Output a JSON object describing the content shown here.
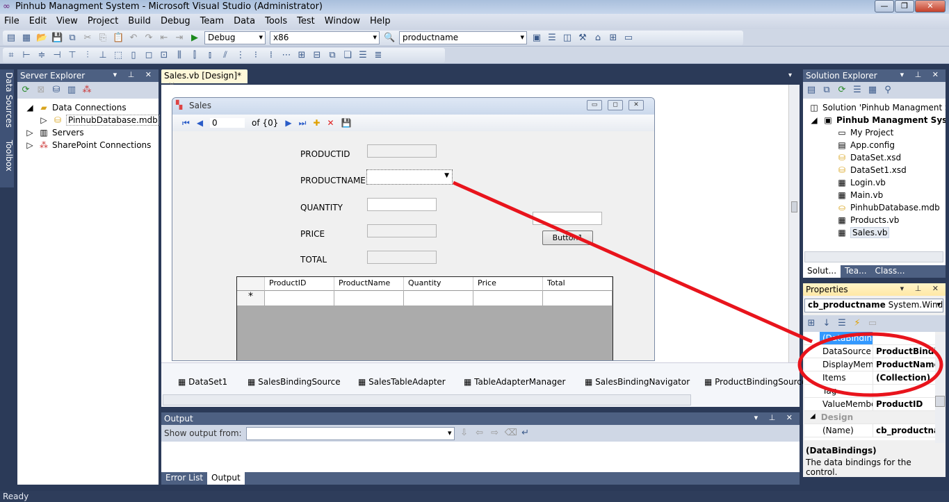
{
  "window": {
    "title": "Pinhub Managment System - Microsoft Visual Studio (Administrator)"
  },
  "menu": [
    "File",
    "Edit",
    "View",
    "Project",
    "Build",
    "Debug",
    "Team",
    "Data",
    "Tools",
    "Test",
    "Window",
    "Help"
  ],
  "toolbar": {
    "config": "Debug",
    "platform": "x86",
    "find": "productname"
  },
  "side_tabs": {
    "data_sources": "Data Sources",
    "toolbox": "Toolbox"
  },
  "server_explorer": {
    "title": "Server Explorer",
    "items": [
      "Data Connections",
      "PinhubDatabase.mdb",
      "Servers",
      "SharePoint Connections"
    ]
  },
  "document": {
    "tab": "Sales.vb [Design]*"
  },
  "form": {
    "title": "Sales",
    "nav_position": "0",
    "nav_count": "of {0}",
    "labels": [
      "PRODUCTID",
      "PRODUCTNAME",
      "QUANTITY",
      "PRICE",
      "TOTAL"
    ],
    "button": "Button1",
    "grid_columns": [
      "ProductID",
      "ProductName",
      "Quantity",
      "Price",
      "Total"
    ],
    "new_row_marker": "*"
  },
  "tray": [
    "DataSet1",
    "SalesBindingSource",
    "SalesTableAdapter",
    "TableAdapterManager",
    "SalesBindingNavigator",
    "ProductBindingSource"
  ],
  "output": {
    "title": "Output",
    "show_from_label": "Show output from:",
    "tabs": [
      "Error List",
      "Output"
    ]
  },
  "solution_explorer": {
    "title": "Solution Explorer",
    "solution": "Solution 'Pinhub Managment Sy",
    "project": "Pinhub Managment System",
    "items": [
      "My Project",
      "App.config",
      "DataSet.xsd",
      "DataSet1.xsd",
      "Login.vb",
      "Main.vb",
      "PinhubDatabase.mdb",
      "Products.vb",
      "Sales.vb"
    ],
    "tabs": [
      "Solut...",
      "Tea...",
      "Class..."
    ]
  },
  "properties": {
    "title": "Properties",
    "object": "cb_productname",
    "type": "System.Window",
    "rows": [
      {
        "k": "(DataBindings)",
        "v": ""
      },
      {
        "k": "DataSource",
        "v": "ProductBinding"
      },
      {
        "k": "DisplayMemb",
        "v": "ProductName"
      },
      {
        "k": "Items",
        "v": "(Collection)"
      },
      {
        "k": "Tag",
        "v": ""
      },
      {
        "k": "ValueMembe",
        "v": "ProductID"
      }
    ],
    "category": "Design",
    "name_row": {
      "k": "(Name)",
      "v": "cb_productnam"
    },
    "desc_title": "(DataBindings)",
    "desc_text": "The data bindings for the control."
  },
  "status": "Ready",
  "annotation_color": "#e8141c"
}
